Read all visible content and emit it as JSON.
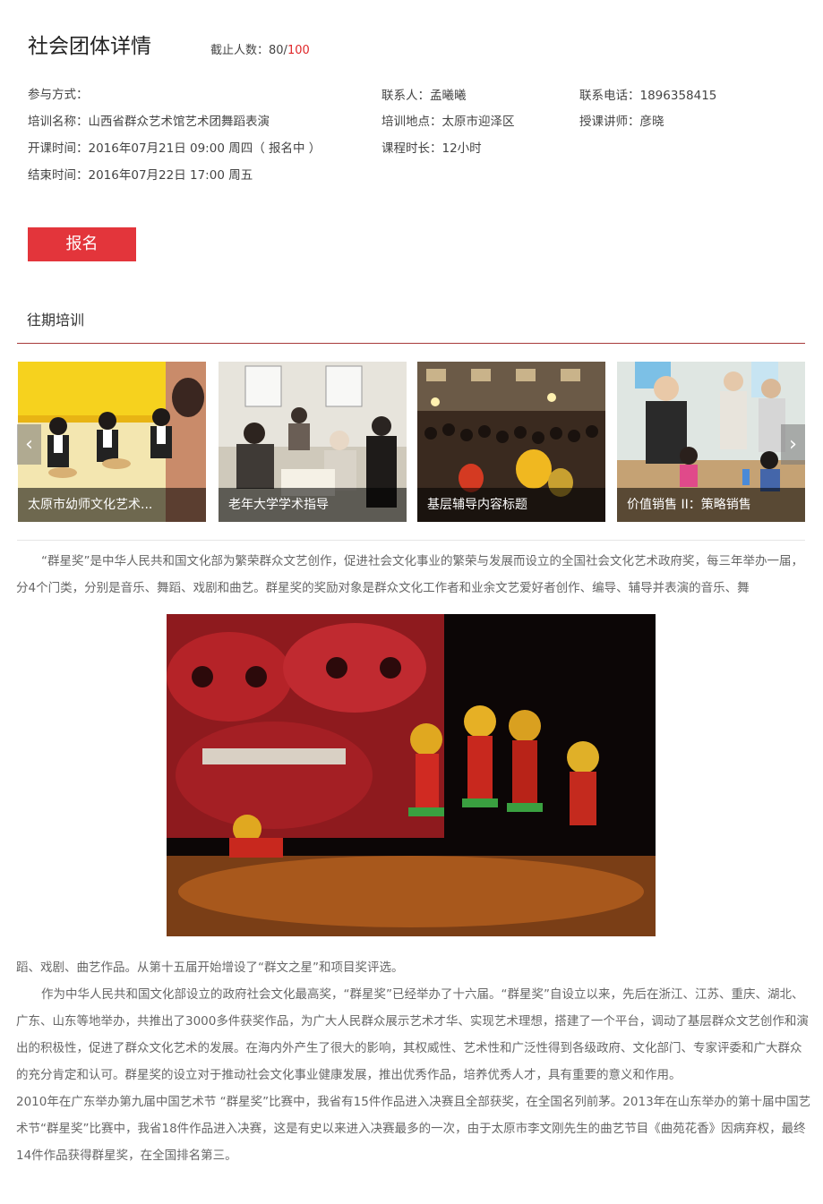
{
  "header": {
    "title": "社会团体详情",
    "capacity_label": "截止人数：",
    "capacity_current": "80/",
    "capacity_max": "100"
  },
  "info": {
    "mode": "参与方式：",
    "contact": "联系人：孟曦曦",
    "phone": "联系电话：1896358415",
    "name": "培训名称：山西省群众艺术馆艺术团舞蹈表演",
    "location": "培训地点：太原市迎泽区",
    "teacher": "授课讲师：彦晓",
    "start": "开课时间：2016年07月21日 09:00 周四（ 报名中 ）",
    "duration": "课程时长：12小时",
    "end": "结束时间：2016年07月22日 17:00 周五"
  },
  "signup_button": "报名",
  "past": {
    "title": "往期培训",
    "prev_icon": "‹",
    "next_icon": "›",
    "items": [
      {
        "label": "太原市幼师文化艺术..."
      },
      {
        "label": "老年大学学术指导"
      },
      {
        "label": "基层辅导内容标题"
      },
      {
        "label": "价值销售 II：策略销售"
      }
    ]
  },
  "article": {
    "p1a": "“群星奖”是中华人民共和国文化部为繁荣群众文艺创作，促进社会文化事业的繁荣与发展而设立的全国社会文化艺术政府奖，每三年举办一届，分4个门类，分别是音乐、舞蹈、戏剧和曲艺。群星奖的奖励对象是群众文化工作者和业余文艺爱好者创作、编导、辅导并表演的音乐、舞",
    "p1b": "蹈、戏剧、曲艺作品。从第十五届开始增设了“群文之星”和项目奖评选。",
    "p2": "作为中华人民共和国文化部设立的政府社会文化最高奖，“群星奖”已经举办了十六届。“群星奖”自设立以来，先后在浙江、江苏、重庆、湖北、广东、山东等地举办，共推出了3000多件获奖作品，为广大人民群众展示艺术才华、实现艺术理想，搭建了一个平台，调动了基层群众文艺创作和演出的积极性，促进了群众文化艺术的发展。在海内外产生了很大的影响，其权威性、艺术性和广泛性得到各级政府、文化部门、专家评委和广大群众的充分肯定和认可。群星奖的设立对于推动社会文化事业健康发展，推出优秀作品，培养优秀人才，具有重要的意义和作用。",
    "p3": "2010年在广东举办第九届中国艺术节 “群星奖”比赛中，我省有15件作品进入决赛且全部获奖，在全国名列前茅。2013年在山东举办的第十届中国艺术节“群星奖”比赛中，我省18件作品进入决赛，这是有史以来进入决赛最多的一次，由于太原市李文刚先生的曲艺节目《曲苑花香》因病弃权，最终14件作品获得群星奖，在全国排名第三。"
  },
  "colors": {
    "accent": "#e3353b",
    "rule": "#a73a3a"
  }
}
